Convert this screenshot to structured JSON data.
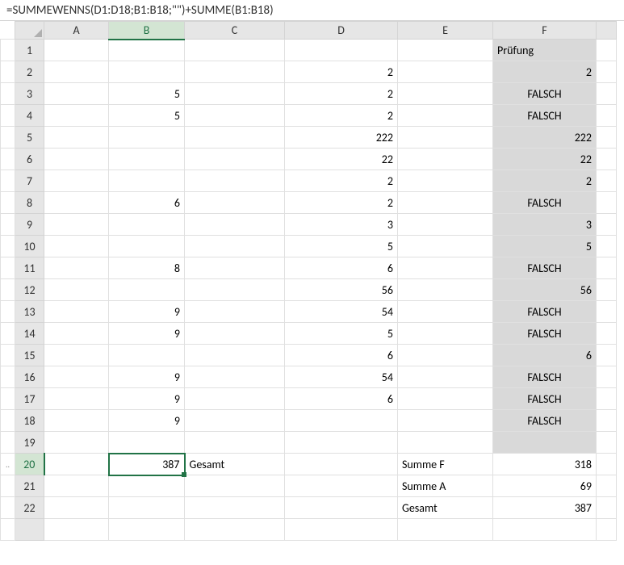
{
  "formula_bar": "=SUMMEWENNS(D1:D18;B1:B18;\"\")+SUMME(B1:B18)",
  "columns": [
    "A",
    "B",
    "C",
    "D",
    "E",
    "F"
  ],
  "active_cell": {
    "row": 20,
    "col": "B"
  },
  "chart_data": {
    "type": "table",
    "columns": [
      "Row",
      "A",
      "B",
      "C",
      "D",
      "E",
      "F"
    ],
    "rows": [
      [
        1,
        "",
        "",
        "",
        "",
        "",
        "Prüfung"
      ],
      [
        2,
        "",
        "",
        "",
        2,
        "",
        2
      ],
      [
        3,
        "",
        5,
        "",
        2,
        "",
        "FALSCH"
      ],
      [
        4,
        "",
        5,
        "",
        2,
        "",
        "FALSCH"
      ],
      [
        5,
        "",
        "",
        "",
        222,
        "",
        222
      ],
      [
        6,
        "",
        "",
        "",
        22,
        "",
        22
      ],
      [
        7,
        "",
        "",
        "",
        2,
        "",
        2
      ],
      [
        8,
        "",
        6,
        "",
        2,
        "",
        "FALSCH"
      ],
      [
        9,
        "",
        "",
        "",
        3,
        "",
        3
      ],
      [
        10,
        "",
        "",
        "",
        5,
        "",
        5
      ],
      [
        11,
        "",
        8,
        "",
        6,
        "",
        "FALSCH"
      ],
      [
        12,
        "",
        "",
        "",
        56,
        "",
        56
      ],
      [
        13,
        "",
        9,
        "",
        54,
        "",
        "FALSCH"
      ],
      [
        14,
        "",
        9,
        "",
        5,
        "",
        "FALSCH"
      ],
      [
        15,
        "",
        "",
        "",
        6,
        "",
        6
      ],
      [
        16,
        "",
        9,
        "",
        54,
        "",
        "FALSCH"
      ],
      [
        17,
        "",
        9,
        "",
        6,
        "",
        "FALSCH"
      ],
      [
        18,
        "",
        9,
        "",
        "",
        "",
        "FALSCH"
      ],
      [
        19,
        "",
        "",
        "",
        "",
        "",
        ""
      ],
      [
        20,
        "",
        387,
        "Gesamt",
        "",
        "Summe F",
        318
      ],
      [
        21,
        "",
        "",
        "",
        "",
        "Summe A",
        69
      ],
      [
        22,
        "",
        "",
        "",
        "",
        "Gesamt",
        387
      ]
    ]
  },
  "labels": {
    "pruefung": "Prüfung",
    "falsch": "FALSCH",
    "gesamt": "Gesamt",
    "summe_f": "Summe F",
    "summe_a": "Summe A"
  },
  "cells": {
    "F1": {
      "v": "Prüfung",
      "t": "txt",
      "s": true
    },
    "D2": {
      "v": 2,
      "t": "num"
    },
    "F2": {
      "v": 2,
      "t": "num",
      "s": true
    },
    "B3": {
      "v": 5,
      "t": "num"
    },
    "D3": {
      "v": 2,
      "t": "num"
    },
    "F3": {
      "v": "FALSCH",
      "t": "txtc",
      "s": true
    },
    "B4": {
      "v": 5,
      "t": "num"
    },
    "D4": {
      "v": 2,
      "t": "num"
    },
    "F4": {
      "v": "FALSCH",
      "t": "txtc",
      "s": true
    },
    "D5": {
      "v": 222,
      "t": "num"
    },
    "F5": {
      "v": 222,
      "t": "num",
      "s": true
    },
    "D6": {
      "v": 22,
      "t": "num"
    },
    "F6": {
      "v": 22,
      "t": "num",
      "s": true
    },
    "D7": {
      "v": 2,
      "t": "num"
    },
    "F7": {
      "v": 2,
      "t": "num",
      "s": true
    },
    "B8": {
      "v": 6,
      "t": "num"
    },
    "D8": {
      "v": 2,
      "t": "num"
    },
    "F8": {
      "v": "FALSCH",
      "t": "txtc",
      "s": true
    },
    "D9": {
      "v": 3,
      "t": "num"
    },
    "F9": {
      "v": 3,
      "t": "num",
      "s": true
    },
    "D10": {
      "v": 5,
      "t": "num"
    },
    "F10": {
      "v": 5,
      "t": "num",
      "s": true
    },
    "B11": {
      "v": 8,
      "t": "num"
    },
    "D11": {
      "v": 6,
      "t": "num"
    },
    "F11": {
      "v": "FALSCH",
      "t": "txtc",
      "s": true
    },
    "D12": {
      "v": 56,
      "t": "num"
    },
    "F12": {
      "v": 56,
      "t": "num",
      "s": true
    },
    "B13": {
      "v": 9,
      "t": "num"
    },
    "D13": {
      "v": 54,
      "t": "num"
    },
    "F13": {
      "v": "FALSCH",
      "t": "txtc",
      "s": true
    },
    "B14": {
      "v": 9,
      "t": "num"
    },
    "D14": {
      "v": 5,
      "t": "num"
    },
    "F14": {
      "v": "FALSCH",
      "t": "txtc",
      "s": true
    },
    "D15": {
      "v": 6,
      "t": "num"
    },
    "F15": {
      "v": 6,
      "t": "num",
      "s": true
    },
    "B16": {
      "v": 9,
      "t": "num"
    },
    "D16": {
      "v": 54,
      "t": "num"
    },
    "F16": {
      "v": "FALSCH",
      "t": "txtc",
      "s": true
    },
    "B17": {
      "v": 9,
      "t": "num"
    },
    "D17": {
      "v": 6,
      "t": "num"
    },
    "F17": {
      "v": "FALSCH",
      "t": "txtc",
      "s": true
    },
    "B18": {
      "v": 9,
      "t": "num"
    },
    "F18": {
      "v": "FALSCH",
      "t": "txtc",
      "s": true
    },
    "B20": {
      "v": 387,
      "t": "num"
    },
    "C20": {
      "v": "Gesamt",
      "t": "txt"
    },
    "E20": {
      "v": "Summe F",
      "t": "txt"
    },
    "F20": {
      "v": 318,
      "t": "num"
    },
    "E21": {
      "v": "Summe A",
      "t": "txt"
    },
    "F21": {
      "v": 69,
      "t": "num"
    },
    "E22": {
      "v": "Gesamt",
      "t": "txt"
    },
    "F22": {
      "v": 387,
      "t": "num"
    }
  },
  "shaded_blank": [
    "F19"
  ],
  "row_count": 22
}
